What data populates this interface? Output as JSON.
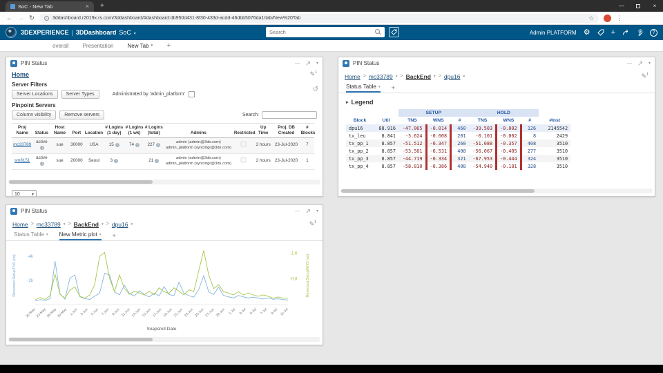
{
  "browser": {
    "tab_title": "SoC - New Tab",
    "url": "3ddashboard.r2019x.rs.com/3ddashboard/#dashboard:db950d431-8f30-433d-acdd-46dbb5076da1/tab/New%20Tab"
  },
  "icons": {
    "back": "←",
    "forward": "→",
    "reload": "↻",
    "star": "☆",
    "menu": "⋮",
    "close": "×",
    "minimize": "—",
    "caret": "▾",
    "plus": "+",
    "gear": "⚙",
    "help": "?",
    "pencil": "✎",
    "reset": "↺",
    "legend_arrow": "▸",
    "info": "i",
    "breadcrumb_sep": ">"
  },
  "header": {
    "brand": "3DEXPERIENCE",
    "divider": "|",
    "app": "3DDashboard",
    "dashboard": "SoC",
    "search_placeholder": "Search",
    "user": "Admin PLATFORM"
  },
  "dash_tabs": {
    "tab1": "overall",
    "tab2": "Presentation",
    "tab3": "New Tab"
  },
  "widget_title": "PIN Status",
  "edit_badge": "1",
  "widget1": {
    "home_link": "Home",
    "server_filters_label": "Server Filters",
    "server_locations_button": "Server Locations",
    "server_types_button": "Server Types",
    "admin_checkbox_label": "Administrated by 'admin_platform'",
    "pinpoint_label": "Pinpoint Servers",
    "column_visibility_button": "Column visibility",
    "remove_servers_button": "Remove servers",
    "search_label": "Search:",
    "page_size": "10",
    "table": {
      "columns": [
        "Proj\nName",
        "Status",
        "Host\nName",
        "Port",
        "Location",
        "# Logins\n(1 day)",
        "# Logins\n(1 wk)",
        "# Logins\n(total)",
        "Admins",
        "Restricted",
        "Up\nTime",
        "Proj. DB\nCreated",
        "#\nBlocks"
      ],
      "rows": [
        {
          "proj": "mc33789",
          "status": "active",
          "host": "sue",
          "port": "30000",
          "location": "USA",
          "logins_1day": "15",
          "logins_1wk": "74",
          "logins_total": "227",
          "admins": "admin (admin@3ds.com)\nadmin_platform (syncmgr@3ds.com)",
          "up_time": "2 hours",
          "created": "23-Jul-2020",
          "blocks": "7"
        },
        {
          "proj": "sm8151",
          "status": "active",
          "host": "sue",
          "port": "20000",
          "location": "Seoul",
          "logins_1day": "3",
          "logins_1wk": "",
          "logins_total": "21",
          "admins": "admin (admin@3ds.com)\nadmin_platform (syncmgr@3ds.com)",
          "up_time": "2 hours",
          "created": "23-Jul-2020",
          "blocks": "1"
        }
      ]
    }
  },
  "breadcrumb": {
    "home": "Home",
    "project": "mc33789",
    "stage": "BackEnd",
    "block": "dpu16"
  },
  "widget2": {
    "tab_status_table": "Status Table",
    "legend_label": "Legend",
    "table": {
      "group_setup": "SETUP",
      "group_hold": "HOLD",
      "columns": [
        "Block",
        "Util",
        "TNS",
        "WNS",
        "#",
        "TNS",
        "WNS",
        "#",
        "#Inst"
      ],
      "rows": [
        [
          "dpu16",
          "88.916",
          "-47.065",
          "-0.014",
          "460",
          "-39.503",
          "-0.002",
          "126",
          "2145542"
        ],
        [
          "tx_leu",
          "8.841",
          "-3.624",
          "-0.008",
          "201",
          "-0.101",
          "-0.002",
          "8",
          "2429"
        ],
        [
          "tx_pp_1",
          "8.857",
          "-51.512",
          "-0.347",
          "260",
          "-51.088",
          "-0.357",
          "408",
          "3510"
        ],
        [
          "tx_pp_2",
          "8.857",
          "-53.581",
          "-0.531",
          "408",
          "-56.067",
          "-0.405",
          "277",
          "3510"
        ],
        [
          "tx_pp_3",
          "8.857",
          "-44.719",
          "-0.334",
          "321",
          "-67.953",
          "-0.444",
          "324",
          "3510"
        ],
        [
          "tx_pp_4",
          "8.857",
          "-58.810",
          "-0.386",
          "408",
          "-54.940",
          "-0.181",
          "328",
          "3510"
        ]
      ]
    }
  },
  "widget3": {
    "tab_status_table": "Status Table",
    "tab_metric_plot": "New Metric plot"
  },
  "chart_data": {
    "type": "line",
    "xlabel": "Snapshot Date",
    "x_ticks": [
      "20-May",
      "23-May",
      "26-May",
      "29-May",
      "1-Jun",
      "3-Jun",
      "5-Jun",
      "7-Jun",
      "9-Jun",
      "11-Jun",
      "13-Jun",
      "15-Jun",
      "17-Jun",
      "19-Jun",
      "21-Jun",
      "23-Jun",
      "25-Jun",
      "27-Jun",
      "29-Jun",
      "1-Jul",
      "3-Jul",
      "5-Jul",
      "7-Jul",
      "9-Jul",
      "11-Jul"
    ],
    "left_axis": {
      "label": "Reversed.SetupTNS (ns)",
      "color": "#7aa9d6",
      "min": -4800,
      "ticks": [
        {
          "label": "-4k",
          "value": -4000
        },
        {
          "label": "-2k",
          "value": -2000
        }
      ]
    },
    "right_axis": {
      "label": "Reversed.SetupWNS (ns)",
      "color": "#a3c63c",
      "min": -1.8,
      "ticks": [
        {
          "label": "-1.6",
          "value": -1.6
        },
        {
          "label": "-0.8",
          "value": -0.8
        }
      ]
    },
    "series": [
      {
        "name": "Reversed.SetupTNS",
        "axis": "left",
        "color": "#86b4dc",
        "values": [
          -300,
          -420,
          -350,
          -500,
          -3600,
          -900,
          -450,
          -2200,
          -2450,
          -650,
          -500,
          -430,
          -700,
          -950,
          -2600,
          -2450,
          -1050,
          -820,
          -1600,
          -920,
          -720,
          -1150,
          -830,
          -640,
          -950,
          -720,
          -1500,
          -840,
          -730,
          -1850,
          -950,
          -740,
          -620,
          -1250,
          -2400,
          -1050,
          -840,
          -1450,
          -760,
          -640,
          -540,
          -760,
          -640,
          -540,
          -620,
          -540,
          -470,
          -540,
          -440,
          -480,
          -420,
          -380
        ]
      },
      {
        "name": "Reversed.SetupWNS",
        "axis": "right",
        "color": "#a5c74a",
        "values": [
          -0.15,
          -0.22,
          -0.16,
          -0.28,
          -0.95,
          -0.32,
          -0.2,
          -0.45,
          -0.55,
          -0.26,
          -0.2,
          -0.3,
          -0.62,
          -1.5,
          -1.62,
          -0.82,
          -0.4,
          -0.92,
          -0.5,
          -0.32,
          -0.42,
          -0.36,
          -0.3,
          -0.42,
          -0.3,
          -0.52,
          -0.4,
          -0.35,
          -0.52,
          -0.42,
          -0.3,
          -0.46,
          -0.4,
          -1.05,
          -1.68,
          -0.92,
          -0.5,
          -0.62,
          -0.4,
          -0.36,
          -0.3,
          -0.4,
          -0.3,
          -0.36,
          -0.3,
          -0.26,
          -0.3,
          -0.26,
          -0.2,
          -0.24,
          -0.2,
          -0.2
        ]
      }
    ]
  },
  "colors": {
    "header_bg": "#005686",
    "red_bar": "#b03030",
    "red_text": "#8b2222",
    "count_text": "#264d8e",
    "table_header_text": "#2458a6",
    "group_bg": "#d9e3f3",
    "link": "#2e6da4"
  }
}
